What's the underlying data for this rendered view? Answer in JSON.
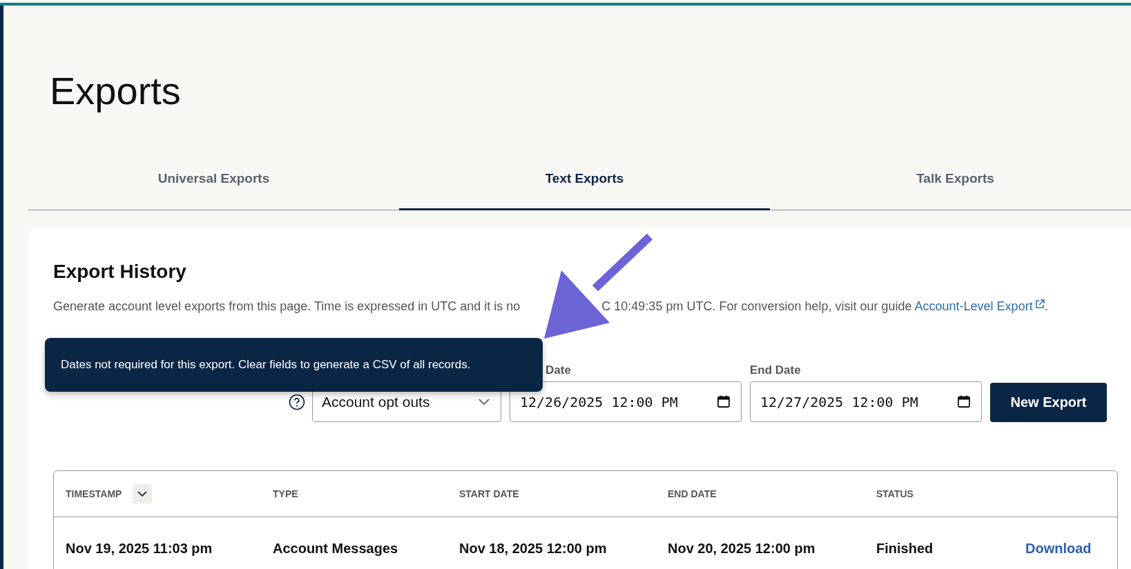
{
  "page": {
    "title": "Exports"
  },
  "tabs": [
    {
      "label": "Universal Exports",
      "selected": false
    },
    {
      "label": "Text Exports",
      "selected": true
    },
    {
      "label": "Talk Exports",
      "selected": false
    }
  ],
  "export_history": {
    "heading": "Export History",
    "description_before": "Generate account level exports from this page. Time is expressed in UTC and it is no",
    "description_after": "C 10:49:35 pm UTC. For conversion help, visit our guide",
    "guide_link": "Account-Level Export",
    "description_end": "."
  },
  "form": {
    "type_select": {
      "value": "Account opt outs"
    },
    "start_date": {
      "label": "Date",
      "value": "12/26/2025 12:00 PM"
    },
    "end_date": {
      "label": "End Date",
      "value": "12/27/2025 12:00 PM"
    },
    "button": "New Export"
  },
  "tooltip": {
    "text": "Dates not required for this export. Clear fields to generate a CSV of all records."
  },
  "table": {
    "columns": [
      {
        "label": "TIMESTAMP",
        "sortable": true
      },
      {
        "label": "TYPE",
        "sortable": false
      },
      {
        "label": "START DATE",
        "sortable": false
      },
      {
        "label": "END DATE",
        "sortable": false
      },
      {
        "label": "STATUS",
        "sortable": false
      }
    ],
    "rows": [
      {
        "cells": [
          "Nov 19, 2025 11:03 pm",
          "Account Messages",
          "Nov 18, 2025 12:00 pm",
          "Nov 20, 2025 12:00 pm",
          "Finished"
        ],
        "action": "Download"
      }
    ]
  }
}
